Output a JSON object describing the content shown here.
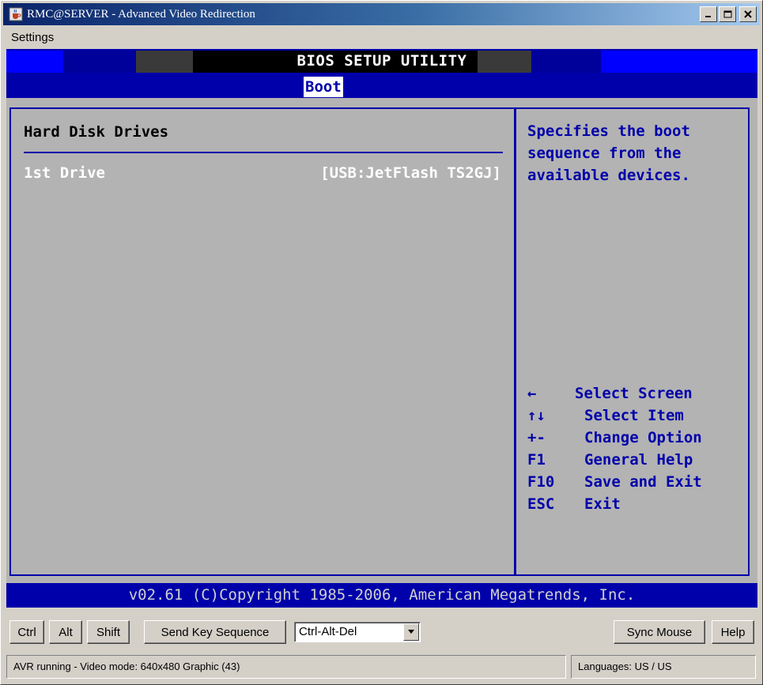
{
  "window": {
    "title": "RMC@SERVER - Advanced Video Redirection",
    "icon": "java-cup-icon"
  },
  "menubar": {
    "settings_label": "Settings"
  },
  "bios": {
    "title": "BIOS SETUP UTILITY",
    "active_tab": "Boot",
    "section_title": "Hard Disk Drives",
    "drives": [
      {
        "label": "1st Drive",
        "value": "[USB:JetFlash TS2GJ]"
      }
    ],
    "help_text": "Specifies the boot sequence from the available devices.",
    "keys": [
      {
        "key": "←",
        "desc": "Select Screen"
      },
      {
        "key": "↑↓",
        "desc": "Select Item"
      },
      {
        "key": "+-",
        "desc": "Change Option"
      },
      {
        "key": "F1",
        "desc": "General Help"
      },
      {
        "key": "F10",
        "desc": "Save and Exit"
      },
      {
        "key": "ESC",
        "desc": "Exit"
      }
    ],
    "footer": "v02.61 (C)Copyright 1985-2006, American Megatrends, Inc.",
    "colors": {
      "background": "#b3b3b3",
      "bar": "#0000aa",
      "text_blue": "#0000aa",
      "text_white": "#ffffff"
    }
  },
  "toolbar": {
    "ctrl_label": "Ctrl",
    "alt_label": "Alt",
    "shift_label": "Shift",
    "send_key_label": "Send Key Sequence",
    "key_sequence_selected": "Ctrl-Alt-Del",
    "sync_mouse_label": "Sync Mouse",
    "help_label": "Help"
  },
  "statusbar": {
    "status_text": "AVR running - Video mode: 640x480 Graphic (43)",
    "languages_text": "Languages: US / US"
  }
}
